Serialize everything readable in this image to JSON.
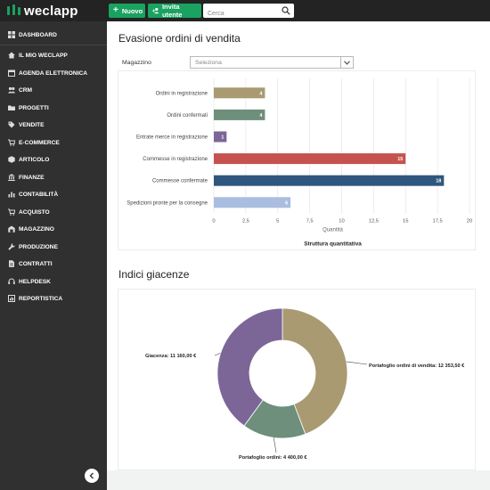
{
  "topbar": {
    "logo_text": "weclapp",
    "new_button_label": "Nuovo",
    "invite_button_label": "Invita utente",
    "search_placeholder": "Cerca",
    "brand_color": "#1aa260"
  },
  "sidebar": {
    "items": [
      {
        "label": "DASHBOARD",
        "icon": "dashboard-icon"
      },
      {
        "label": "IL MIO WECLAPP",
        "icon": "home-icon"
      },
      {
        "label": "AGENDA ELETTRONICA",
        "icon": "calendar-icon"
      },
      {
        "label": "CRM",
        "icon": "crm-icon"
      },
      {
        "label": "PROGETTI",
        "icon": "folder-icon"
      },
      {
        "label": "VENDITE",
        "icon": "tag-icon"
      },
      {
        "label": "E-COMMERCE",
        "icon": "cart-icon"
      },
      {
        "label": "ARTICOLO",
        "icon": "box-icon"
      },
      {
        "label": "FINANZE",
        "icon": "finance-icon"
      },
      {
        "label": "CONTABILITÀ",
        "icon": "chart-icon"
      },
      {
        "label": "ACQUISTO",
        "icon": "purchase-icon"
      },
      {
        "label": "MAGAZZINO",
        "icon": "warehouse-icon"
      },
      {
        "label": "PRODUZIONE",
        "icon": "wrench-icon"
      },
      {
        "label": "CONTRATTI",
        "icon": "document-icon"
      },
      {
        "label": "HELPDESK",
        "icon": "headset-icon"
      },
      {
        "label": "REPORTISTICA",
        "icon": "report-icon"
      }
    ],
    "collapse_icon": "chevron-left-icon"
  },
  "sales": {
    "title": "Evasione ordini di vendita",
    "warehouse_label": "Magazzino",
    "warehouse_placeholder": "Seleziona"
  },
  "stock": {
    "title": "Indici giacenze"
  },
  "chart_data": [
    {
      "type": "bar",
      "orientation": "horizontal",
      "categories": [
        "Ordini in registrazione",
        "Ordini confermati",
        "Entrate merce in registrazione",
        "Commesse in registrazione",
        "Commesse confermate",
        "Spedizioni pronte per la consegne"
      ],
      "values": [
        4,
        4,
        1,
        15,
        18,
        6
      ],
      "value_labels": [
        "4",
        "4",
        "1",
        "15",
        "18",
        "6"
      ],
      "colors": [
        "#a99a72",
        "#6d8f7c",
        "#7c6698",
        "#c6524f",
        "#2f577e",
        "#a9bde0"
      ],
      "xlabel": "Quantità",
      "title": "Struttura quantitativa",
      "xlim": [
        0,
        20
      ],
      "xticks": [
        "0",
        "2,5",
        "5",
        "7,5",
        "10",
        "12,5",
        "15",
        "17,5",
        "20"
      ],
      "grid": true
    },
    {
      "type": "pie",
      "donut": true,
      "slices": [
        {
          "label": "Portafoglio ordini di vendita",
          "value": 12353.5,
          "display": "Portafoglio ordini di vendita: 12 353,50 €",
          "color": "#a99a72"
        },
        {
          "label": "Portafoglio ordini",
          "value": 4400.0,
          "display": "Portafoglio ordini: 4 400,00 €",
          "color": "#6d8f7c"
        },
        {
          "label": "Giacenza",
          "value": 11160.0,
          "display": "Giacenza: 11 160,00 €",
          "color": "#7c6698"
        }
      ]
    }
  ]
}
